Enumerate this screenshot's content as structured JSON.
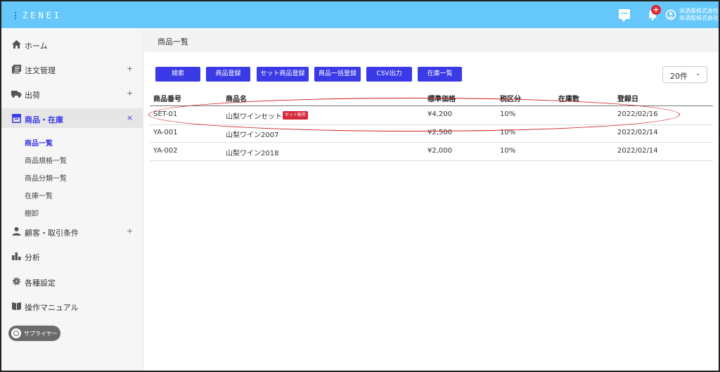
{
  "header": {
    "logo": "ZENEI",
    "notification_count": "+",
    "company_line1": "栄酒般株式会社",
    "company_line2": "栄酒般株式会社"
  },
  "sidebar": {
    "items": [
      {
        "label": "ホーム",
        "icon": "home-icon"
      },
      {
        "label": "注文管理",
        "icon": "orders-icon",
        "expand": "+"
      },
      {
        "label": "出荷",
        "icon": "truck-icon",
        "expand": "+"
      },
      {
        "label": "商品・在庫",
        "icon": "inventory-icon",
        "expand": "×"
      },
      {
        "label": "顧客・取引条件",
        "icon": "person-icon",
        "expand": "+"
      },
      {
        "label": "分析",
        "icon": "chart-icon"
      },
      {
        "label": "各種設定",
        "icon": "gear-icon"
      },
      {
        "label": "操作マニュアル",
        "icon": "book-icon"
      }
    ],
    "sub_items": [
      "商品一覧",
      "商品規格一覧",
      "商品分類一覧",
      "在庫一覧",
      "棚卸"
    ],
    "supplier_button": "サプライヤー"
  },
  "main": {
    "breadcrumb": "商品一覧",
    "buttons": {
      "search": "検索",
      "register": "商品登録",
      "set_register": "セット商品登録",
      "bulk_register": "商品一括登録",
      "csv_export": "CSV出力",
      "stock_list": "在庫一覧"
    },
    "per_page": "20件",
    "columns": [
      "商品番号",
      "商品名",
      "標準価格",
      "税区分",
      "在庫数",
      "登録日"
    ],
    "rows": [
      {
        "code": "SET-01",
        "name": "山梨ワインセット",
        "badge": "セット販売",
        "price": "¥4,200",
        "tax": "10%",
        "stock": "",
        "date": "2022/02/16"
      },
      {
        "code": "YA-001",
        "name": "山梨ワイン2007",
        "badge": "",
        "price": "¥2,500",
        "tax": "10%",
        "stock": "",
        "date": "2022/02/14"
      },
      {
        "code": "YA-002",
        "name": "山梨ワイン2018",
        "badge": "",
        "price": "¥2,000",
        "tax": "10%",
        "stock": "",
        "date": "2022/02/14"
      }
    ]
  },
  "colors": {
    "header": "#66c8fa",
    "primary_button": "#3a3ae6",
    "badge": "#d42a3a",
    "highlight_oval": "#d01f1f"
  }
}
